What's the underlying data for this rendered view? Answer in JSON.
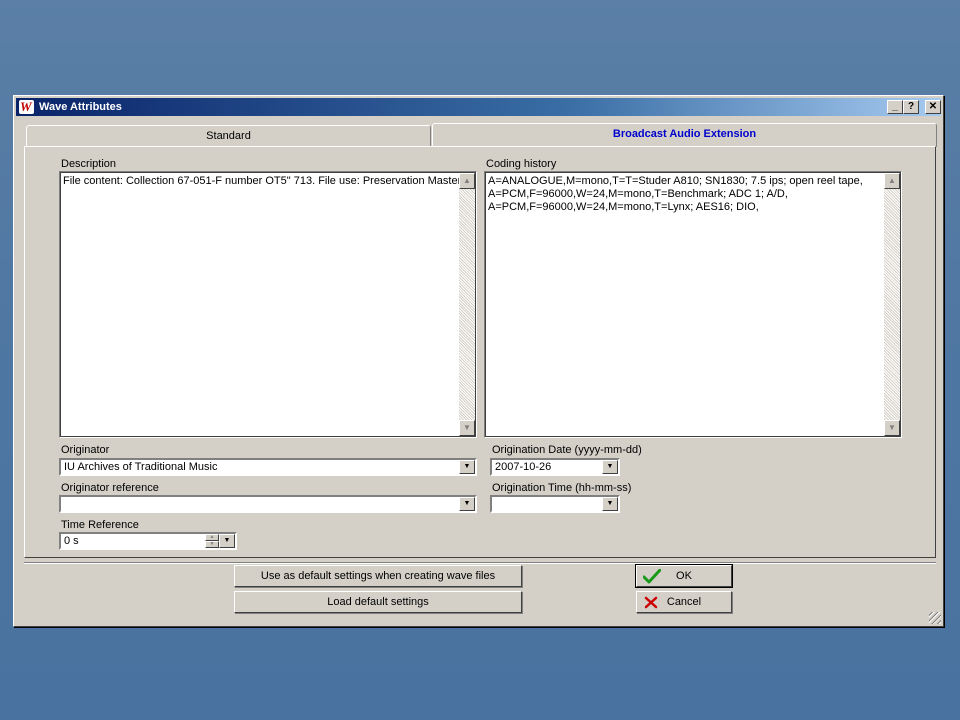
{
  "window": {
    "title": "Wave Attributes",
    "controls": {
      "minimize": "_",
      "help": "?",
      "close": "✕"
    }
  },
  "tabs": [
    {
      "label": "Standard",
      "active": false
    },
    {
      "label": "Broadcast Audio Extension",
      "active": true
    }
  ],
  "description": {
    "label": "Description",
    "value": "File content: Collection 67-051-F number OT5\" 713. File use: Preservation Master. IU"
  },
  "coding_history": {
    "label": "Coding history",
    "lines": [
      "A=ANALOGUE,M=mono,T=T=Studer A810; SN1830; 7.5  ips; open reel tape,",
      "A=PCM,F=96000,W=24,M=mono,T=Benchmark; ADC 1; A/D,",
      "A=PCM,F=96000,W=24,M=mono,T=Lynx; AES16; DIO,"
    ]
  },
  "originator": {
    "label": "Originator",
    "value": "IU Archives of Traditional Music"
  },
  "originator_reference": {
    "label": "Originator reference",
    "value": ""
  },
  "origination_date": {
    "label": "Origination Date (yyyy-mm-dd)",
    "value": "2007-10-26"
  },
  "origination_time": {
    "label": "Origination Time (hh-mm-ss)",
    "value": ""
  },
  "time_reference": {
    "label": "Time Reference",
    "value": "0 s"
  },
  "buttons": {
    "use_default": "Use as default settings when creating wave files",
    "load_default": "Load default settings",
    "ok": "OK",
    "cancel": "Cancel"
  },
  "colors": {
    "title_bar": "#0a246a",
    "active_tab_text": "#0000cc",
    "ok_check": "#1a9a1a",
    "cancel_x": "#cc0000"
  }
}
